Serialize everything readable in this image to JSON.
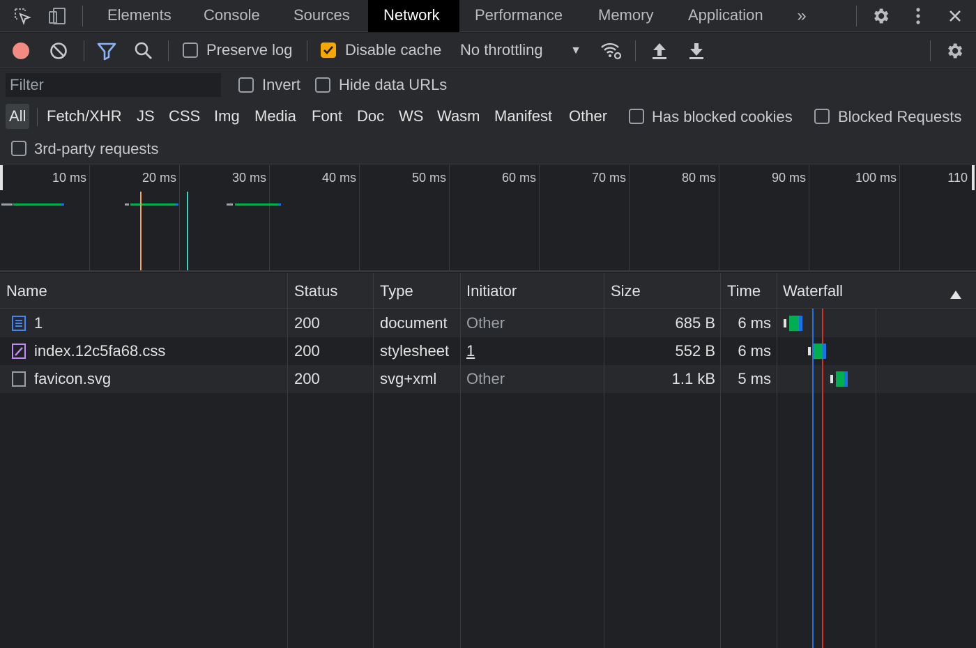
{
  "tabs": [
    "Elements",
    "Console",
    "Sources",
    "Network",
    "Performance",
    "Memory",
    "Application"
  ],
  "active_tab": "Network",
  "toolbar": {
    "preserve_log": "Preserve log",
    "disable_cache": "Disable cache",
    "throttling": "No throttling"
  },
  "filter": {
    "placeholder": "Filter",
    "invert": "Invert",
    "hide_data_urls": "Hide data URLs",
    "types": [
      "All",
      "Fetch/XHR",
      "JS",
      "CSS",
      "Img",
      "Media",
      "Font",
      "Doc",
      "WS",
      "Wasm",
      "Manifest",
      "Other"
    ],
    "active_type": "All",
    "has_blocked_cookies": "Has blocked cookies",
    "blocked_requests": "Blocked Requests",
    "third_party": "3rd-party requests"
  },
  "overview": {
    "ticks": [
      "10 ms",
      "20 ms",
      "30 ms",
      "40 ms",
      "50 ms",
      "60 ms",
      "70 ms",
      "80 ms",
      "90 ms",
      "100 ms",
      "110"
    ]
  },
  "table": {
    "headers": {
      "name": "Name",
      "status": "Status",
      "type": "Type",
      "initiator": "Initiator",
      "size": "Size",
      "time": "Time",
      "waterfall": "Waterfall"
    },
    "rows": [
      {
        "name": "1",
        "status": "200",
        "type": "document",
        "initiator": "Other",
        "size": "685 B",
        "time": "6 ms",
        "icon": "document-icon"
      },
      {
        "name": "index.12c5fa68.css",
        "status": "200",
        "type": "stylesheet",
        "initiator": "1",
        "size": "552 B",
        "time": "6 ms",
        "icon": "stylesheet-icon"
      },
      {
        "name": "favicon.svg",
        "status": "200",
        "type": "svg+xml",
        "initiator": "Other",
        "size": "1.1 kB",
        "time": "5 ms",
        "icon": "file-icon"
      }
    ]
  },
  "colors": {
    "record": "#f28b82",
    "accent": "#f6a700",
    "filter_icon": "#8ab4f8",
    "bar_green": "#00b050",
    "bar_blue": "#1a73e8",
    "dom_line": "#1a73e8",
    "load_line": "#d93025"
  }
}
